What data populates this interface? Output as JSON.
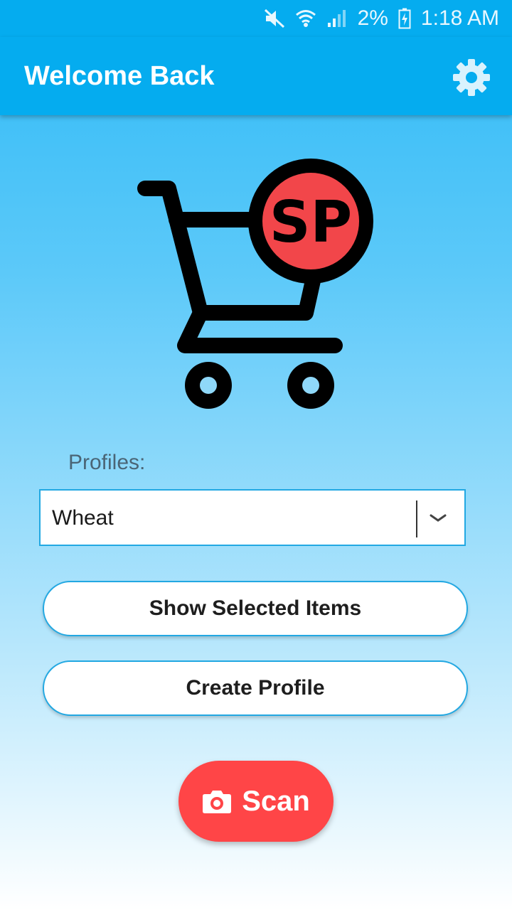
{
  "status_bar": {
    "battery_percent": "2%",
    "time": "1:18 AM",
    "icons": [
      "mute-icon",
      "wifi-icon",
      "signal-icon",
      "battery-charging-icon"
    ]
  },
  "app_bar": {
    "title": "Welcome Back",
    "settings_icon": "gear-icon"
  },
  "logo": {
    "text": "SP",
    "badge_color": "#f2464a",
    "cart_color": "#000000"
  },
  "profiles": {
    "label": "Profiles:",
    "selected": "Wheat"
  },
  "buttons": {
    "show_selected": "Show Selected Items",
    "create_profile": "Create Profile",
    "scan": "Scan"
  },
  "colors": {
    "app_bar": "#05acef",
    "accent_border": "#22a8e2",
    "scan_button": "#ff4547"
  }
}
